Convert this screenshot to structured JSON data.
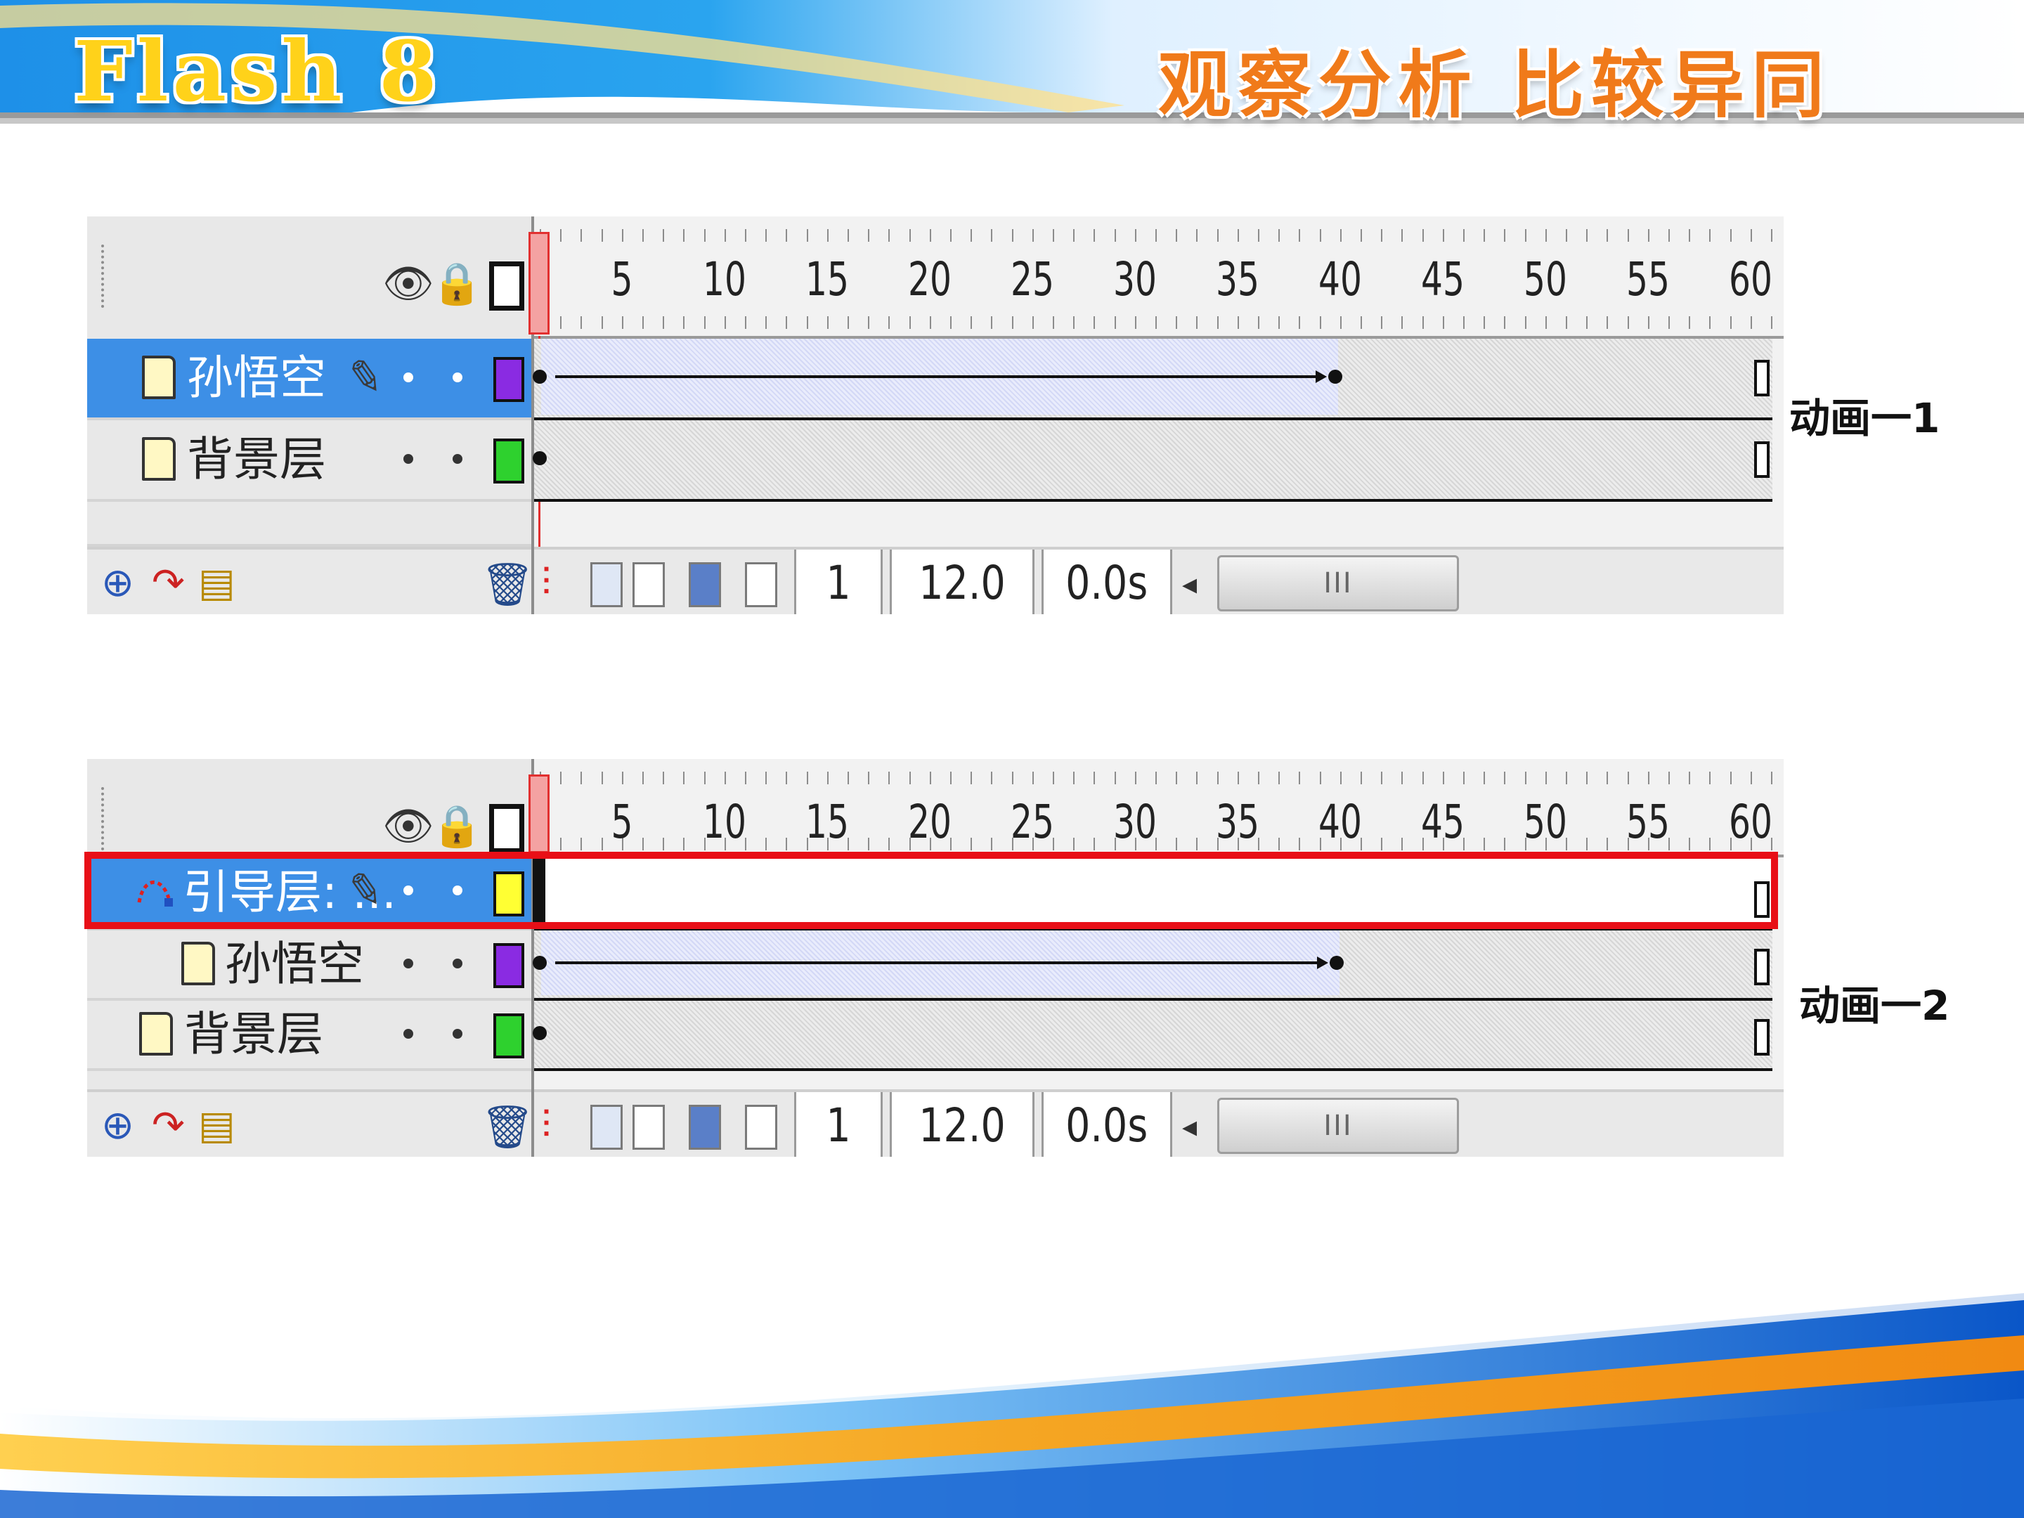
{
  "header": {
    "logo": "Flash 8",
    "title": "观察分析 比较异同"
  },
  "frame_numbers": [
    "1",
    "5",
    "10",
    "15",
    "20",
    "25",
    "30",
    "35",
    "40",
    "45",
    "50",
    "55",
    "60"
  ],
  "timeline1": {
    "label": "动画一1",
    "layers": [
      {
        "name": "孙悟空",
        "color": "#8a2be2",
        "selected": true
      },
      {
        "name": "背景层",
        "color": "#2ed12e",
        "selected": false
      }
    ],
    "status": {
      "frame": "1",
      "fps": "12.0 fps",
      "time": "0.0s",
      "scroll_grip": "III"
    }
  },
  "timeline2": {
    "label": "动画一2",
    "layers": [
      {
        "name": "引导层: ...",
        "color": "#ffff33",
        "selected": true
      },
      {
        "name": "孙悟空",
        "color": "#8a2be2",
        "selected": false
      },
      {
        "name": "背景层",
        "color": "#2ed12e",
        "selected": false
      }
    ],
    "status": {
      "frame": "1",
      "fps": "12.0 fps",
      "time": "0.0s",
      "scroll_grip": "III"
    }
  },
  "colors": {
    "accent": "#f07a1a",
    "highlight": "#e80f17",
    "selection": "#3d8fe6"
  }
}
